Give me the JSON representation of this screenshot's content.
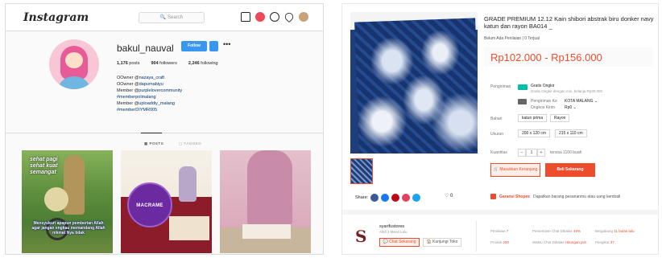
{
  "instagram": {
    "logo": "Instagram",
    "search_placeholder": "🔍 Search",
    "username": "bakul_nauval",
    "follow_label": "Follow",
    "more_label": "•••",
    "stats": [
      {
        "count": "1,176",
        "label": "posts"
      },
      {
        "count": "904",
        "label": "followers"
      },
      {
        "count": "2,246",
        "label": "following"
      }
    ],
    "bio": [
      {
        "prefix": "OOwner @",
        "link": "nazaya_craft"
      },
      {
        "prefix": "OOwner @",
        "link": "dapurnabiyu"
      },
      {
        "prefix": "Member @",
        "link": "purplelovercommunity"
      },
      {
        "prefix": "",
        "link": "#memberpolmalang"
      },
      {
        "prefix": "Member @",
        "link": "uploaddiy_malang"
      },
      {
        "prefix": "",
        "link": "#memberDIYMR005"
      }
    ],
    "tabs": {
      "posts": "▦ POSTS",
      "tagged": "▢ TAGGED"
    },
    "tiles": {
      "t1_top": "sehat pagi\nsehat kuat\nsemangat",
      "t1_bottom": "Mensyukuri apapun pemberian Allah agar jangan engkau memandang Allah nikmat Nya tidak",
      "t2_text": "MACRAME"
    }
  },
  "shopee": {
    "title": "GRADE PREMIUM 12.12 Kain shibori abstrak biru donker navy katun dan rayon BA014 _",
    "meta": "Belum Ada Penilaian  |  0 Terjual",
    "price": "Rp102.000 - Rp156.000",
    "shipping_label": "Pengiriman",
    "free_shipping": "Gratis Ongkir",
    "free_shipping_desc": "Gratis Ongkir dengan min. belanja Rp30.000",
    "shipping_to_label": "Pengiriman Ke",
    "shipping_to_value": "KOTA MALANG ⌄",
    "shipping_cost_label": "Ongkos Kirim",
    "shipping_cost_value": "Rp0 ⌄",
    "material_label": "Bahan",
    "material_options": [
      "katun prima",
      "Rayon"
    ],
    "size_label": "Ukuran",
    "size_options": [
      "200 x 120 cm",
      "215 x 110 cm"
    ],
    "qty_label": "Kuantitas",
    "qty_minus": "−",
    "qty_value": "1",
    "qty_plus": "+",
    "stock_text": "tersisa 1100 buah",
    "cart_label": "🛒 Masukkan Keranjang",
    "buy_label": "Beli Sekarang",
    "guarantee_brand": "Garansi Shopee",
    "guarantee_desc": "Dapatkan barang pesananmu atau uang kembali",
    "share_label": "Share:",
    "share_colors": [
      "#3b5998",
      "#1da1f2",
      "#e4405f",
      "#bd081c",
      "#1da1f2"
    ],
    "favorite_label": "♡ 0",
    "shop": {
      "logo": "S",
      "name": "syarifustores",
      "status": "Aktif 2 Menit Lalu",
      "chat": "💬 Chat Sekarang",
      "visit": "🏠 Kunjungi Toko",
      "stats_row1": [
        {
          "label": "Penilaian",
          "value": "7"
        },
        {
          "label": "Persentase Chat Dibalas",
          "value": "49%"
        },
        {
          "label": "Bergabung",
          "value": "11 bulan lalu"
        }
      ],
      "stats_row2": [
        {
          "label": "Produk",
          "value": "290"
        },
        {
          "label": "Waktu Chat Dibalas",
          "value": "Hitungan jam"
        },
        {
          "label": "Pengikut",
          "value": "37"
        }
      ]
    }
  }
}
